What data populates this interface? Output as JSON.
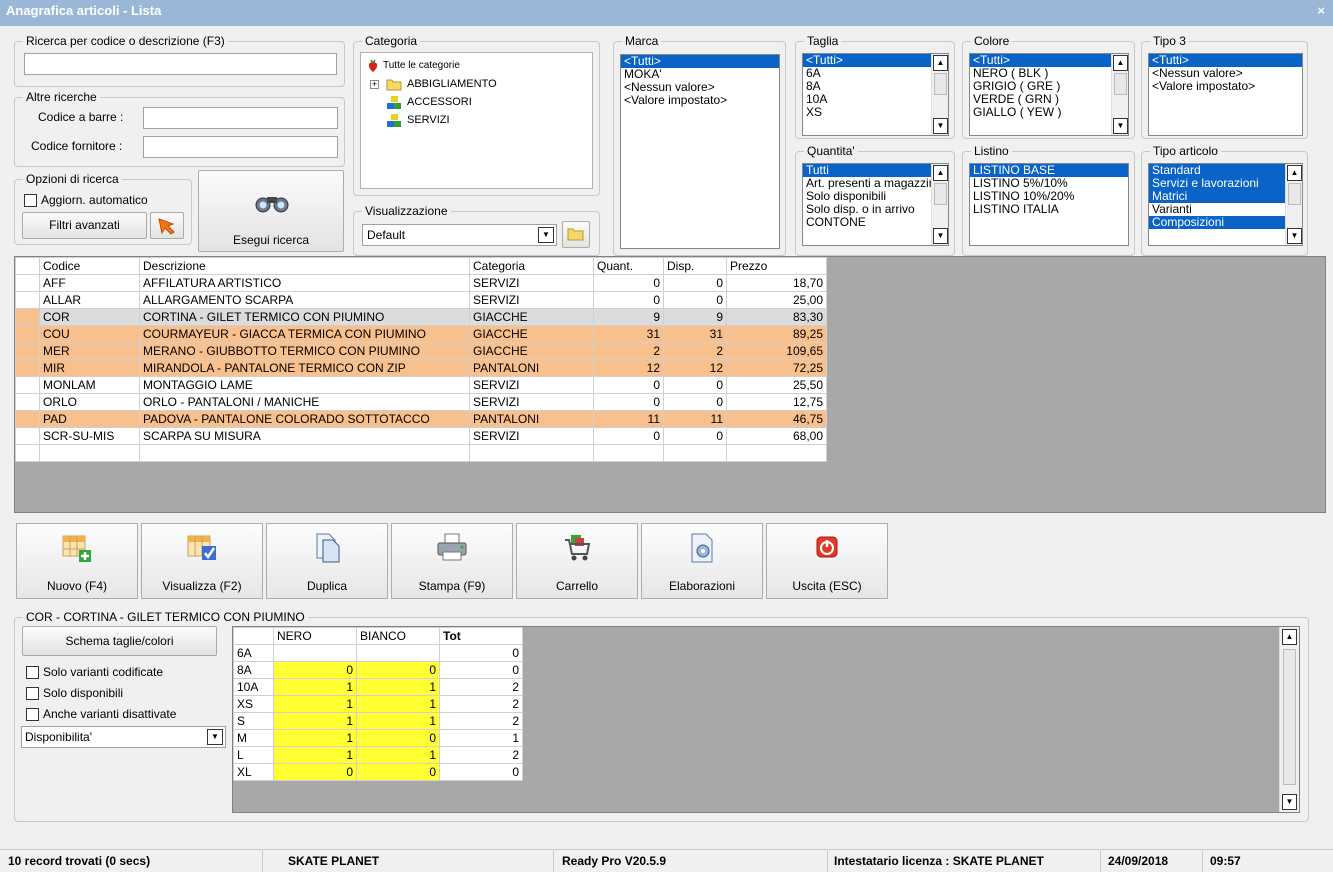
{
  "window": {
    "title": "Anagrafica articoli  - Lista",
    "close": "×"
  },
  "search": {
    "legend": "Ricerca per codice o descrizione (F3)",
    "value": ""
  },
  "altre": {
    "legend": "Altre ricerche",
    "barcode_label": "Codice a barre :",
    "supplier_label": "Codice fornitore :"
  },
  "opzioni": {
    "legend": "Opzioni di ricerca",
    "auto_update": "Aggiorn. automatico",
    "advanced": "Filtri avanzati"
  },
  "esegui": "Esegui ricerca",
  "categoria": {
    "legend": "Categoria",
    "root": "Tutte le categorie",
    "items": [
      "ABBIGLIAMENTO",
      "ACCESSORI",
      "SERVIZI"
    ]
  },
  "visualizzazione": {
    "legend": "Visualizzazione",
    "value": "Default"
  },
  "marca": {
    "legend": "Marca",
    "items": [
      "<Tutti>",
      "MOKA'",
      "<Nessun valore>",
      "<Valore impostato>"
    ]
  },
  "taglia": {
    "legend": "Taglia",
    "items": [
      "<Tutti>",
      "6A",
      "8A",
      "10A",
      "XS"
    ]
  },
  "colore": {
    "legend": "Colore",
    "items": [
      "<Tutti>",
      "NERO ( BLK )",
      "GRIGIO ( GRE )",
      "VERDE ( GRN )",
      "GIALLO ( YEW )"
    ]
  },
  "tipo3": {
    "legend": "Tipo 3",
    "items": [
      "<Tutti>",
      "<Nessun valore>",
      "<Valore impostato>"
    ]
  },
  "quantita": {
    "legend": "Quantita'",
    "items": [
      "Tutti",
      "Art. presenti a magazzino",
      "Solo disponibili",
      "Solo disp. o in arrivo",
      "CONTONE"
    ]
  },
  "listino": {
    "legend": "Listino",
    "items": [
      "LISTINO BASE",
      "LISTINO 5%/10%",
      "LISTINO 10%/20%",
      "LISTINO ITALIA"
    ]
  },
  "tipo_articolo": {
    "legend": "Tipo articolo",
    "items": [
      "Standard",
      "Servizi e lavorazioni",
      "Matrici",
      "Varianti",
      "Composizioni"
    ]
  },
  "grid": {
    "headers": [
      "Codice",
      "Descrizione",
      "Categoria",
      "Quant.",
      "Disp.",
      "Prezzo"
    ],
    "rows": [
      {
        "codice": "AFF",
        "descrizione": "AFFILATURA ARTISTICO",
        "categoria": "SERVIZI",
        "quant": "0",
        "disp": "0",
        "prezzo": "18,70",
        "style": "white"
      },
      {
        "codice": "ALLAR",
        "descrizione": "ALLARGAMENTO SCARPA",
        "categoria": "SERVIZI",
        "quant": "0",
        "disp": "0",
        "prezzo": "25,00",
        "style": "white"
      },
      {
        "codice": "COR",
        "descrizione": "CORTINA - GILET TERMICO CON PIUMINO",
        "categoria": "GIACCHE",
        "quant": "9",
        "disp": "9",
        "prezzo": "83,30",
        "style": "selected"
      },
      {
        "codice": "COU",
        "descrizione": "COURMAYEUR - GIACCA TERMICA CON PIUMINO",
        "categoria": "GIACCHE",
        "quant": "31",
        "disp": "31",
        "prezzo": "89,25",
        "style": "orange"
      },
      {
        "codice": "MER",
        "descrizione": "MERANO - GIUBBOTTO TERMICO CON PIUMINO",
        "categoria": "GIACCHE",
        "quant": "2",
        "disp": "2",
        "prezzo": "109,65",
        "style": "orange"
      },
      {
        "codice": "MIR",
        "descrizione": "MIRANDOLA - PANTALONE TERMICO CON ZIP",
        "categoria": "PANTALONI",
        "quant": "12",
        "disp": "12",
        "prezzo": "72,25",
        "style": "orange"
      },
      {
        "codice": "MONLAM",
        "descrizione": "MONTAGGIO LAME",
        "categoria": "SERVIZI",
        "quant": "0",
        "disp": "0",
        "prezzo": "25,50",
        "style": "white"
      },
      {
        "codice": "ORLO",
        "descrizione": "ORLO - PANTALONI / MANICHE",
        "categoria": "SERVIZI",
        "quant": "0",
        "disp": "0",
        "prezzo": "12,75",
        "style": "white"
      },
      {
        "codice": "PAD",
        "descrizione": "PADOVA - PANTALONE COLORADO SOTTOTACCO",
        "categoria": "PANTALONI",
        "quant": "11",
        "disp": "11",
        "prezzo": "46,75",
        "style": "orange"
      },
      {
        "codice": "SCR-SU-MIS",
        "descrizione": "SCARPA SU MISURA",
        "categoria": "SERVIZI",
        "quant": "0",
        "disp": "0",
        "prezzo": "68,00",
        "style": "white"
      }
    ]
  },
  "toolbar": [
    "Nuovo (F4)",
    "Visualizza (F2)",
    "Duplica",
    "Stampa (F9)",
    "Carrello",
    "Elaborazioni",
    "Uscita (ESC)"
  ],
  "detail": {
    "legend": "COR - CORTINA - GILET TERMICO CON PIUMINO",
    "schema_button": "Schema taglie/colori",
    "checks": [
      "Solo varianti codificate",
      "Solo disponibili",
      "Anche varianti disattivate"
    ],
    "select": "Disponibilita'",
    "headers": [
      "NERO",
      "BIANCO",
      "Tot"
    ],
    "rows": [
      {
        "size": "6A",
        "nero": "",
        "bianco": "",
        "tot": "0"
      },
      {
        "size": "8A",
        "nero": "0",
        "bianco": "0",
        "tot": "0"
      },
      {
        "size": "10A",
        "nero": "1",
        "bianco": "1",
        "tot": "2"
      },
      {
        "size": "XS",
        "nero": "1",
        "bianco": "1",
        "tot": "2"
      },
      {
        "size": "S",
        "nero": "1",
        "bianco": "1",
        "tot": "2"
      },
      {
        "size": "M",
        "nero": "1",
        "bianco": "0",
        "tot": "1"
      },
      {
        "size": "L",
        "nero": "1",
        "bianco": "1",
        "tot": "2"
      },
      {
        "size": "XL",
        "nero": "0",
        "bianco": "0",
        "tot": "0"
      }
    ]
  },
  "status": {
    "records": "10 record trovati (0 secs)",
    "company": "SKATE PLANET",
    "version": "Ready Pro V20.5.9",
    "license": "Intestatario licenza : SKATE PLANET",
    "date": "24/09/2018",
    "time": "09:57"
  },
  "colors": {
    "selection": "#0a64c8",
    "orange_row": "#f8c08c",
    "selected_row": "#dcdcdc",
    "yellow_cell": "#ffff33"
  }
}
